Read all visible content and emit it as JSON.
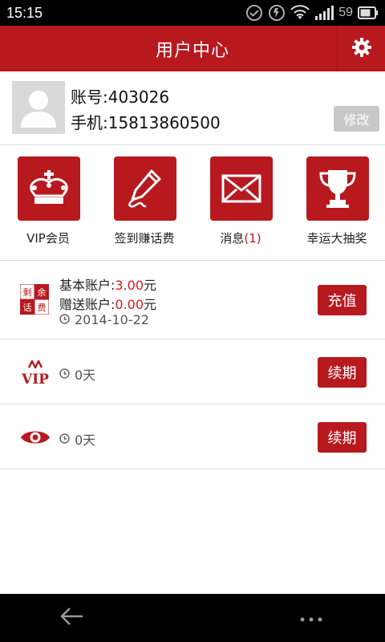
{
  "status_bar": {
    "time": "15:15",
    "battery": "59"
  },
  "header": {
    "title": "用户中心"
  },
  "profile": {
    "account": "账号:403026",
    "phone": "手机:15813860500",
    "edit_label": "修改"
  },
  "features": [
    {
      "label": "VIP会员",
      "icon": "crown-icon"
    },
    {
      "label": "签到赚话费",
      "icon": "pencil-sign-icon"
    },
    {
      "label": "消息",
      "count": "(1)",
      "icon": "envelope-icon"
    },
    {
      "label": "幸运大抽奖",
      "icon": "trophy-icon"
    }
  ],
  "balance": {
    "icon_chars": [
      "剩",
      "余",
      "话",
      "费"
    ],
    "basic_label": "基本账户:",
    "basic_value": "3.00",
    "basic_unit": "元",
    "gift_label": "赠送账户:",
    "gift_value": "0.00",
    "gift_unit": "元",
    "date": "2014-10-22",
    "recharge_label": "充值"
  },
  "vip": {
    "icon_text": "VIP",
    "days": "0天",
    "renew_label": "续期"
  },
  "eye": {
    "days": "0天",
    "renew_label": "续期"
  },
  "colors": {
    "brand": "#b7191f",
    "accent_text": "#d71920"
  }
}
